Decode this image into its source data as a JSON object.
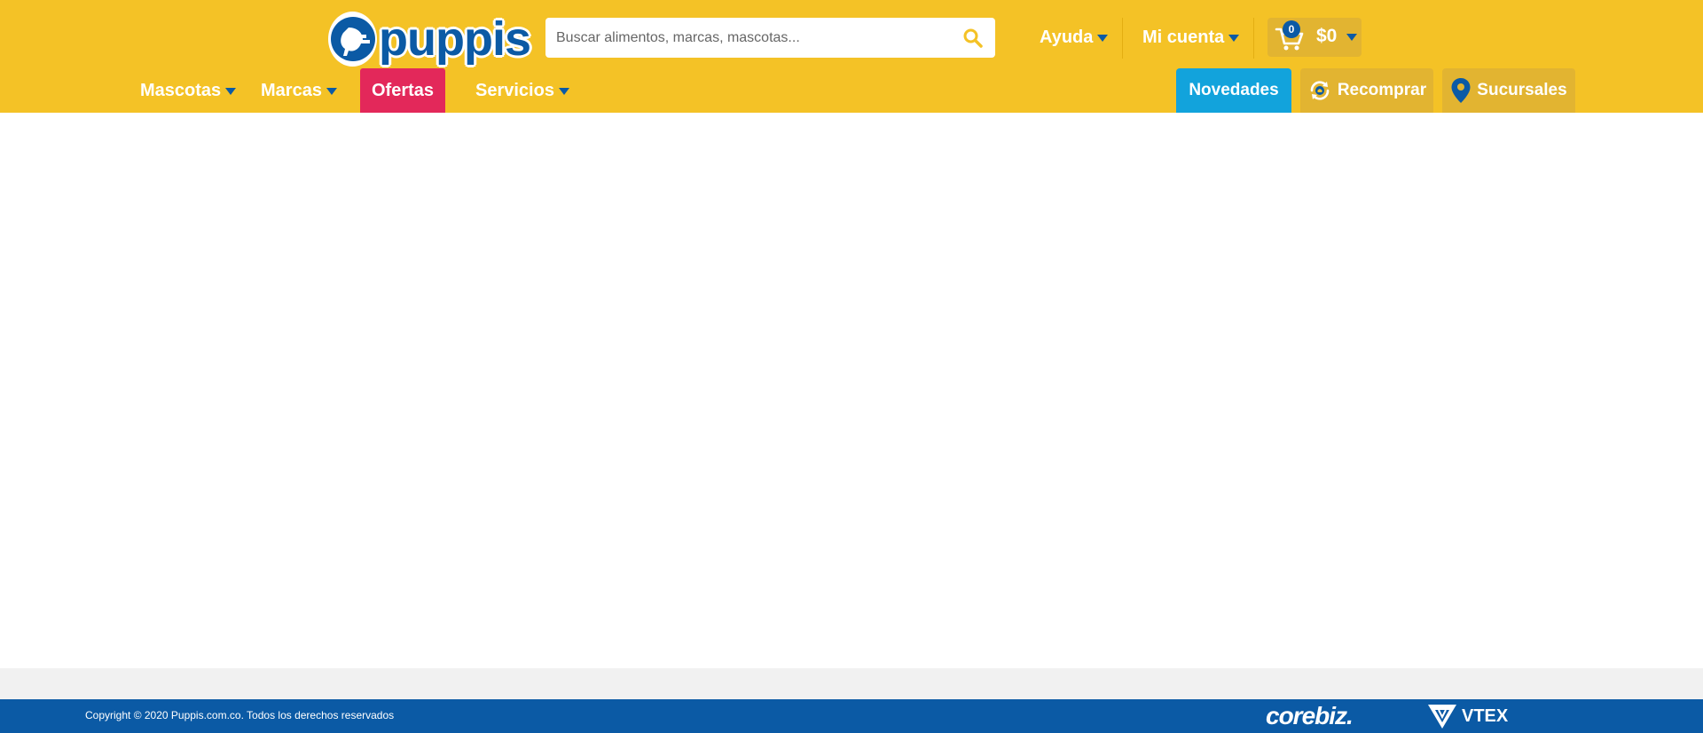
{
  "brand": {
    "name": "puppis",
    "primary_color": "#f4c226",
    "secondary_color": "#0b5aa5"
  },
  "search": {
    "placeholder": "Buscar alimentos, marcas, mascotas...",
    "value": ""
  },
  "top_links": {
    "help_label": "Ayuda",
    "account_label": "Mi cuenta"
  },
  "cart": {
    "count": "0",
    "total": "$0"
  },
  "nav": {
    "items": [
      {
        "label": "Mascotas"
      },
      {
        "label": "Marcas"
      },
      {
        "label": "Ofertas"
      },
      {
        "label": "Servicios"
      }
    ],
    "pills": {
      "novedades": "Novedades",
      "recomprar": "Recomprar",
      "sucursales": "Sucursales"
    },
    "colors": {
      "ofertas": "#e3285a",
      "novedades": "#12a3dc"
    }
  },
  "footer": {
    "copyright": "Copyright © 2020 Puppis.com.co. Todos los derechos reservados",
    "partner_1": "corebiz.",
    "partner_2": "VTEX"
  }
}
